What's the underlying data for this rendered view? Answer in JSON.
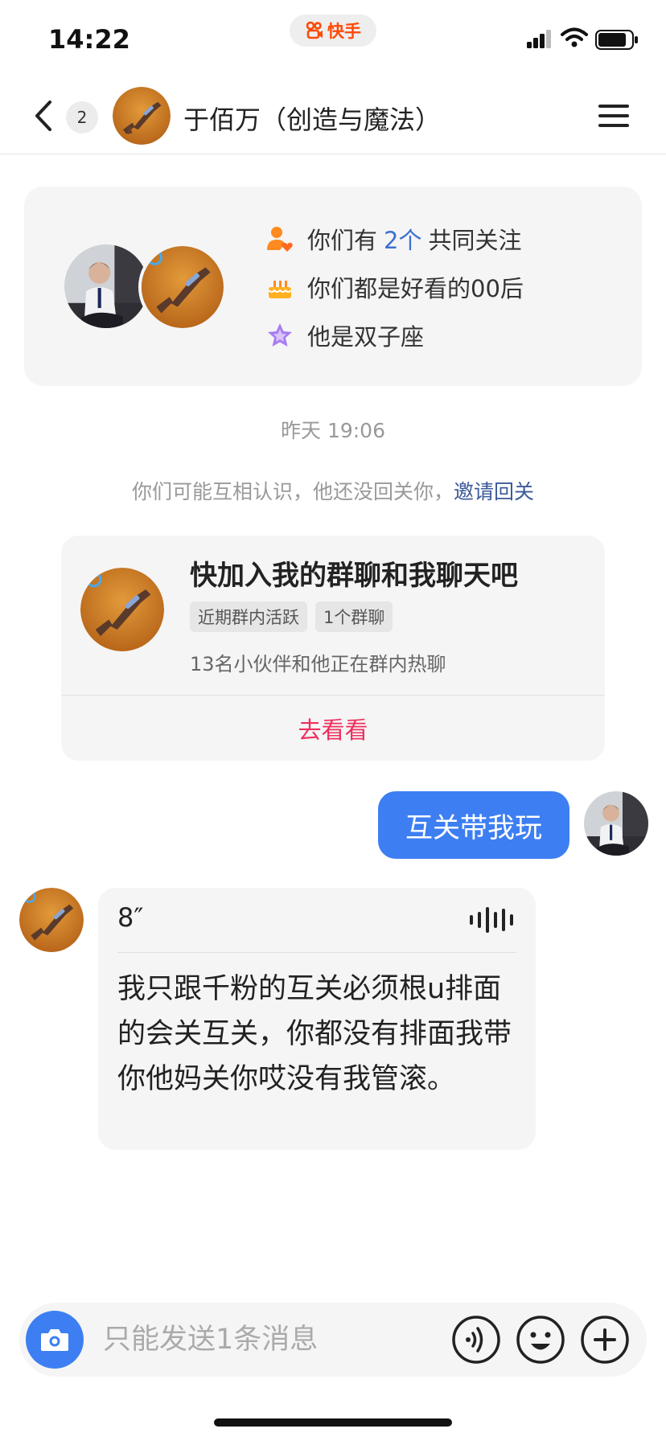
{
  "status_bar": {
    "time": "14:22",
    "app_label": "快手"
  },
  "nav": {
    "unread_count": "2",
    "title": "于佰万（创造与魔法）"
  },
  "mutual_info": {
    "row1_prefix": "你们有",
    "row1_highlight": "2个",
    "row1_suffix": "共同关注",
    "row2": "你们都是好看的00后",
    "row3": "他是双子座"
  },
  "timestamp": "昨天 19:06",
  "system_notice": {
    "text": "你们可能互相认识，他还没回关你，",
    "link": "邀请回关"
  },
  "group_card": {
    "title": "快加入我的群聊和我聊天吧",
    "tags": [
      "近期群内活跃",
      "1个群聊"
    ],
    "description": "13名小伙伴和他正在群内热聊",
    "action": "去看看"
  },
  "messages": {
    "sent_text": "互关带我玩",
    "voice_duration": "8″",
    "voice_transcript": "我只跟千粉的互关必须根u排面的会关互关，你都没有排面我带你他妈关你哎没有我管滚。"
  },
  "input_bar": {
    "placeholder": "只能发送1条消息"
  },
  "colors": {
    "accent": "#3d7ff2",
    "link": "#3c6fd2",
    "action_red": "#ee2f5e",
    "brand_orange": "#ff4906"
  }
}
